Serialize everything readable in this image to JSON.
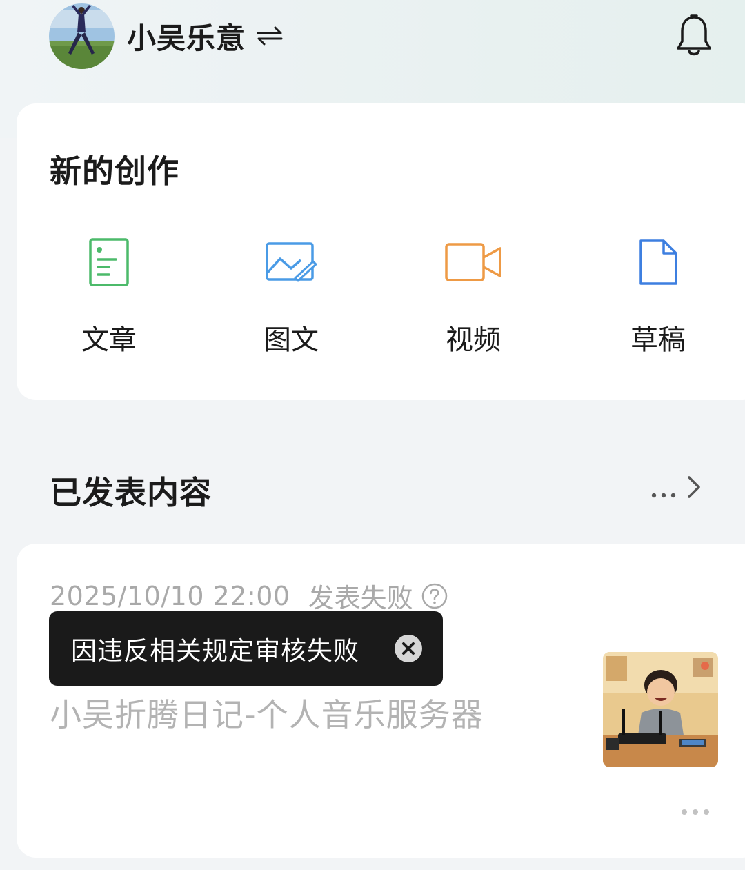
{
  "header": {
    "username": "小吴乐意",
    "icons": {
      "avatar": "user-avatar",
      "switch": "switch-arrows-icon",
      "notification": "bell-icon"
    }
  },
  "create": {
    "title": "新的创作",
    "items": [
      {
        "label": "文章",
        "icon": "article-doc-icon",
        "color": "#4cba6a"
      },
      {
        "label": "图文",
        "icon": "image-text-icon",
        "color": "#4a9be6"
      },
      {
        "label": "视频",
        "icon": "video-camera-icon",
        "color": "#ee9a45"
      },
      {
        "label": "草稿",
        "icon": "draft-file-icon",
        "color": "#3d7fe0"
      }
    ]
  },
  "published": {
    "title": "已发表内容",
    "more_icon": "ellipsis-chevron-icon",
    "items": [
      {
        "date": "2025/10/10 22:00",
        "status": "发表失败",
        "tooltip": "因违反相关规定审核失败",
        "title": "小吴折腾日记-个人音乐服务器",
        "thumbnail": "boy-with-router-image"
      }
    ]
  },
  "colors": {
    "title_text": "#1b1b1b",
    "muted_text": "#a9a9a9",
    "tooltip_bg": "#1a1a1a",
    "card_bg": "#ffffff",
    "page_bg": "#f2f4f6"
  }
}
